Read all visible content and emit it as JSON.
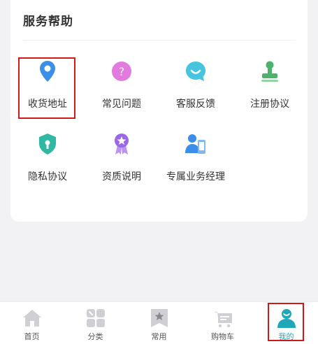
{
  "section": {
    "title": "服务帮助",
    "items": [
      {
        "label": "收货地址",
        "icon": "location-pin-icon",
        "color": "#3b8fe8"
      },
      {
        "label": "常见问题",
        "icon": "question-icon",
        "color": "#d65bd9"
      },
      {
        "label": "客服反馈",
        "icon": "chat-bubble-icon",
        "color": "#47c4de"
      },
      {
        "label": "注册协议",
        "icon": "stamp-icon",
        "color": "#4db36b"
      },
      {
        "label": "隐私协议",
        "icon": "shield-lock-icon",
        "color": "#2fb8a3"
      },
      {
        "label": "资质说明",
        "icon": "medal-icon",
        "color": "#9c66e8"
      },
      {
        "label": "专属业务经理",
        "icon": "manager-icon",
        "color": "#3b8fe8"
      }
    ]
  },
  "tabbar": {
    "items": [
      {
        "label": "首页",
        "icon": "home-icon"
      },
      {
        "label": "分类",
        "icon": "category-icon"
      },
      {
        "label": "常用",
        "icon": "bookmark-star-icon"
      },
      {
        "label": "购物车",
        "icon": "cart-icon"
      },
      {
        "label": "我的",
        "icon": "profile-icon",
        "active": true
      }
    ],
    "active_color": "#1fa8b8",
    "inactive_color": "#cfcfd4"
  }
}
